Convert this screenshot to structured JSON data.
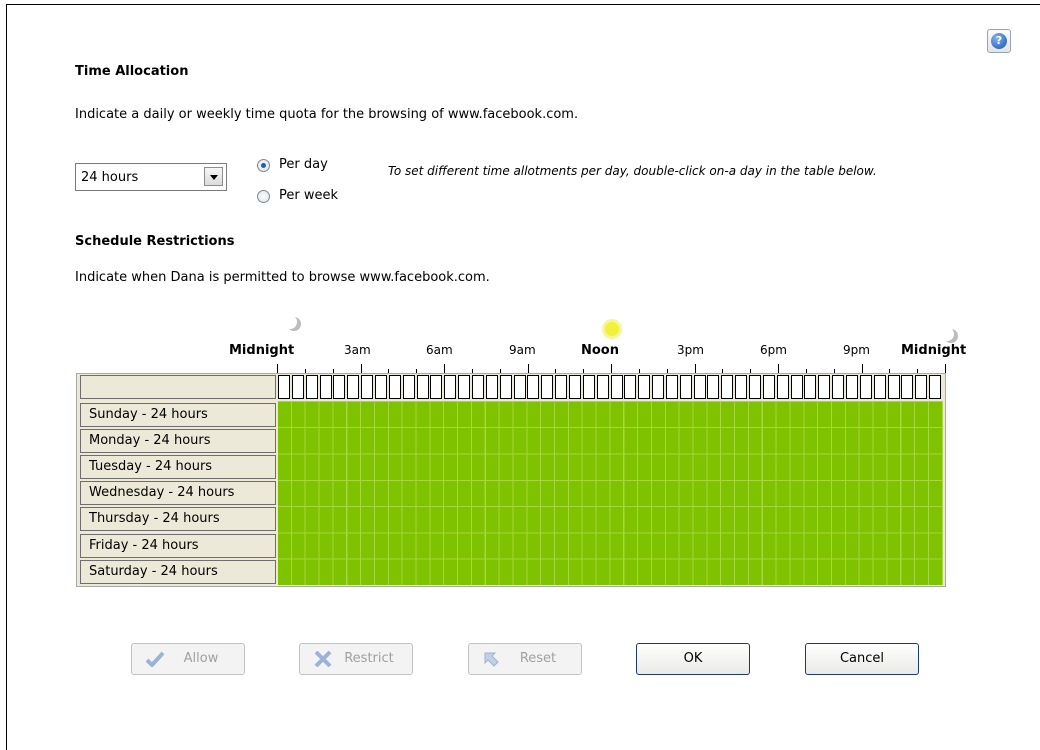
{
  "help": {
    "symbol": "?"
  },
  "time_allocation": {
    "heading": "Time Allocation",
    "description": "Indicate a daily or weekly time quota for the browsing of www.facebook.com.",
    "quota_select": {
      "value": "24 hours"
    },
    "radios": [
      {
        "label": "Per day",
        "checked": true
      },
      {
        "label": "Per week",
        "checked": false
      }
    ],
    "note": "To set different time allotments per day, double-click on-a day in the table below."
  },
  "schedule": {
    "heading": "Schedule Restrictions",
    "description": "Indicate when Dana is permitted to browse www.facebook.com.",
    "time_labels": [
      "Midnight",
      "3am",
      "6am",
      "9am",
      "Noon",
      "3pm",
      "6pm",
      "9pm",
      "Midnight"
    ],
    "days": [
      {
        "label": "Sunday - 24 hours"
      },
      {
        "label": "Monday - 24 hours"
      },
      {
        "label": "Tuesday - 24 hours"
      },
      {
        "label": "Wednesday - 24 hours"
      },
      {
        "label": "Thursday - 24 hours"
      },
      {
        "label": "Friday - 24 hours"
      },
      {
        "label": "Saturday - 24 hours"
      }
    ],
    "allowed_color": "#7fc200"
  },
  "buttons": {
    "allow": "Allow",
    "restrict": "Restrict",
    "reset": "Reset",
    "ok": "OK",
    "cancel": "Cancel"
  }
}
